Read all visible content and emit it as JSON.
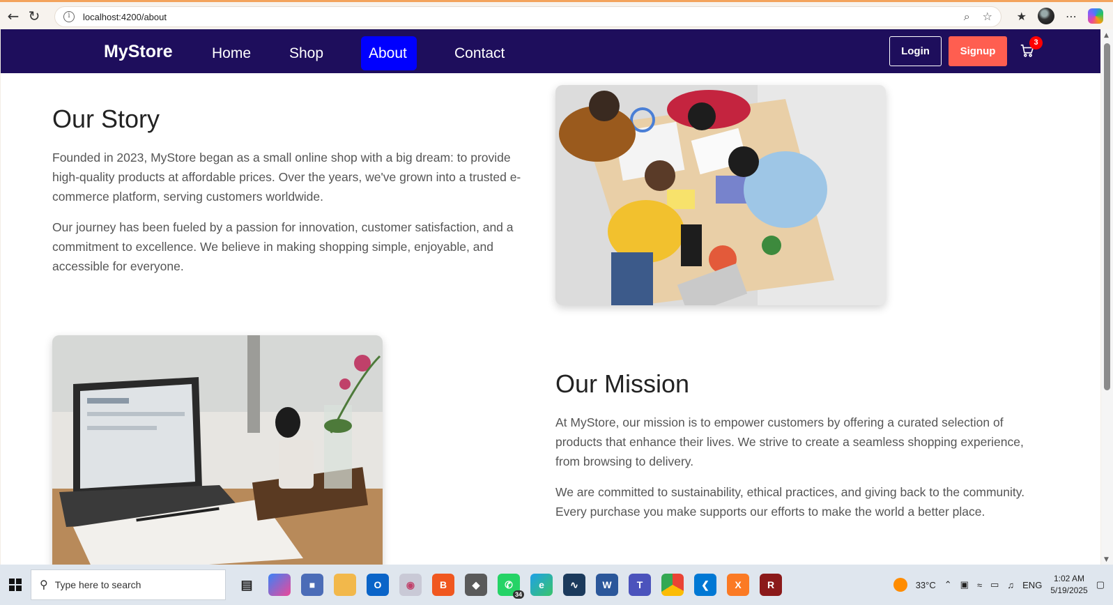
{
  "browser": {
    "url": "localhost:4200/about",
    "back_icon": "back-arrow-icon",
    "reload_icon": "reload-icon"
  },
  "navbar": {
    "brand": "MyStore",
    "links": [
      {
        "label": "Home",
        "active": false
      },
      {
        "label": "Shop",
        "active": false
      },
      {
        "label": "About",
        "active": true
      },
      {
        "label": "Contact",
        "active": false
      }
    ],
    "login_label": "Login",
    "signup_label": "Signup",
    "cart_count": "3"
  },
  "story": {
    "title": "Our Story",
    "paragraph1": "Founded in 2023, MyStore began as a small online shop with a big dream: to provide high-quality products at affordable prices. Over the years, we've grown into a trusted e-commerce platform, serving customers worldwide.",
    "paragraph2": "Our journey has been fueled by a passion for innovation, customer satisfaction, and a commitment to excellence. We believe in making shopping simple, enjoyable, and accessible for everyone."
  },
  "mission": {
    "title": "Our Mission",
    "paragraph1": "At MyStore, our mission is to empower customers by offering a curated selection of products that enhance their lives. We strive to create a seamless shopping experience, from browsing to delivery.",
    "paragraph2": "We are committed to sustainability, ethical practices, and giving back to the community. Every purchase you make supports our efforts to make the world a better place."
  },
  "taskbar": {
    "search_placeholder": "Type here to search",
    "whatsapp_badge": "34",
    "weather": "33°C",
    "language": "ENG",
    "time": "1:02 AM",
    "date": "5/19/2025"
  },
  "colors": {
    "navbar_bg": "#1e0e5c",
    "active_link": "#0000ff",
    "signup": "#ff5e50",
    "badge": "#ff0000"
  }
}
